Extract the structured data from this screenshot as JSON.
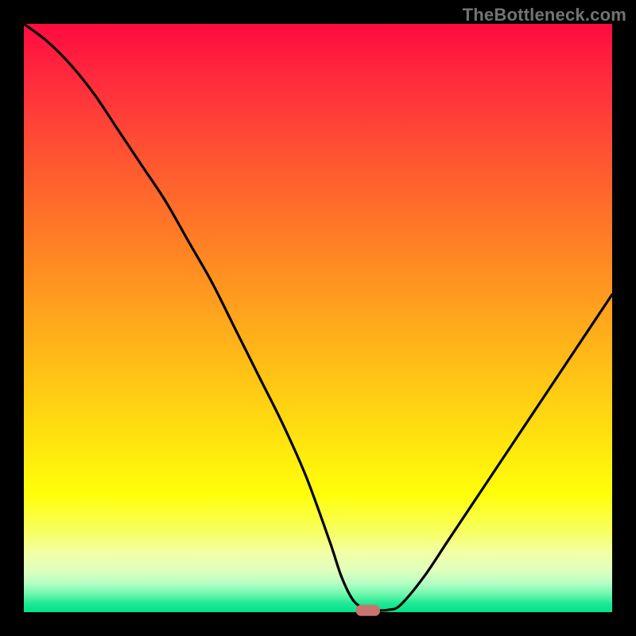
{
  "watermark": "TheBottleneck.com",
  "colors": {
    "frame_bg": "#000000",
    "gradient_top": "#ff0b3f",
    "gradient_mid": "#ffe10f",
    "gradient_bottom": "#00e38a",
    "curve_stroke": "#000000",
    "marker_fill": "#c9736f"
  },
  "chart_data": {
    "type": "line",
    "title": "",
    "xlabel": "",
    "ylabel": "",
    "xlim": [
      0,
      100
    ],
    "ylim": [
      0,
      100
    ],
    "x": [
      0,
      4,
      8,
      12,
      16,
      20,
      24,
      28,
      32,
      36,
      40,
      44,
      48,
      52,
      54,
      56,
      58,
      60,
      62,
      64,
      68,
      72,
      76,
      80,
      84,
      88,
      92,
      96,
      100
    ],
    "values": [
      100,
      97,
      93,
      88,
      82,
      76,
      70,
      63,
      56,
      48,
      40,
      32,
      23,
      12,
      6,
      2,
      0.6,
      0.3,
      0.4,
      1.2,
      6,
      12,
      18,
      24,
      30,
      36,
      42,
      48,
      54
    ],
    "marker": {
      "x": 58.5,
      "y": 0.3,
      "shape": "rounded-rect"
    },
    "annotations": [
      {
        "text": "TheBottleneck.com",
        "position": "top-right"
      }
    ]
  }
}
